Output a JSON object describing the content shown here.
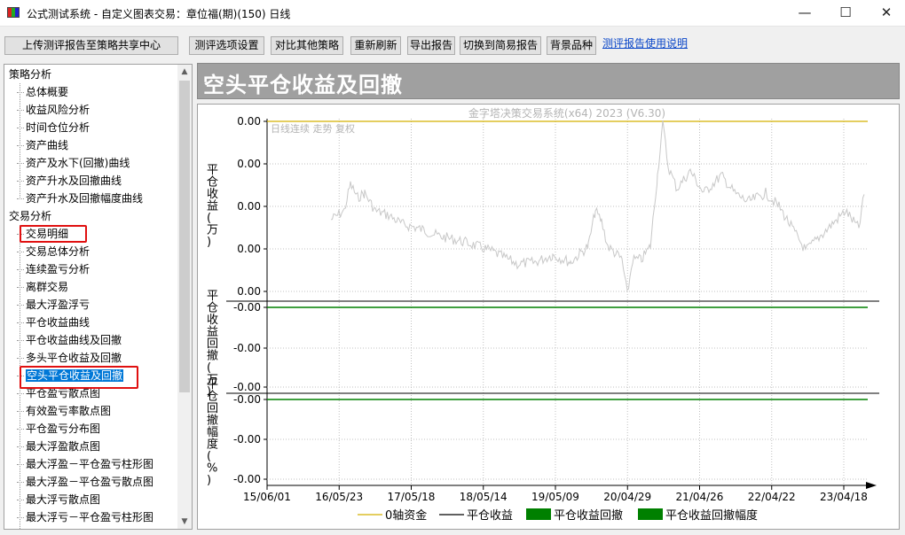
{
  "window": {
    "title": "公式测试系统 - 自定义图表交易：章位福(期)(150) 日线",
    "minimize": "—",
    "maximize": "☐",
    "close": "✕"
  },
  "toolbar": {
    "upload": "上传测评报告至策略共享中心",
    "settings": "测评选项设置",
    "compare": "对比其他策略",
    "refresh": "重新刷新",
    "export": "导出报告",
    "simple": "切换到简易报告",
    "background": "背景品种",
    "help_link": "测评报告使用说明"
  },
  "tree": {
    "groups": [
      {
        "label": "策略分析",
        "items": [
          "总体概要",
          "收益风险分析",
          "时间仓位分析",
          "资产曲线",
          "资产及水下(回撤)曲线",
          "资产升水及回撤曲线",
          "资产升水及回撤幅度曲线"
        ]
      },
      {
        "label": "交易分析",
        "items": [
          "交易明细",
          "交易总体分析",
          "连续盈亏分析",
          "离群交易",
          "最大浮盈浮亏",
          "平仓收益曲线",
          "平仓收益曲线及回撤",
          "多头平仓收益及回撤",
          "空头平仓收益及回撤",
          "平仓盈亏散点图",
          "有效盈亏率散点图",
          "平仓盈亏分布图",
          "最大浮盈散点图",
          "最大浮盈－平仓盈亏柱形图",
          "最大浮盈－平仓盈亏散点图",
          "最大浮亏散点图",
          "最大浮亏－平仓盈亏柱形图"
        ]
      }
    ],
    "selected": "空头平仓收益及回撤"
  },
  "section": {
    "title": "空头平仓收益及回撤"
  },
  "chart_data": {
    "type": "line",
    "watermark": "金字塔决策交易系统(x64) 2023 (V6.30)",
    "sub_caption": "日线连续 走势 复权",
    "panels": [
      {
        "ylabel": "平仓收益(万)",
        "ticks": [
          "0.00",
          "0.00",
          "0.00",
          "0.00",
          "0.00"
        ]
      },
      {
        "ylabel": "平仓收益回撤(万)",
        "ticks": [
          "-0.00",
          "-0.00",
          "-0.00"
        ]
      },
      {
        "ylabel": "平仓回撤幅度(%)",
        "ticks": [
          "-0.00",
          "-0.00",
          "-0.00"
        ]
      }
    ],
    "x_ticks": [
      "15/06/01",
      "16/05/23",
      "17/05/18",
      "18/05/14",
      "19/05/09",
      "20/04/29",
      "21/04/26",
      "22/04/22",
      "23/04/18"
    ],
    "legend": [
      {
        "name": "0轴资金",
        "color": "#d4b000",
        "style": "line"
      },
      {
        "name": "平仓收益",
        "color": "#000000",
        "style": "line"
      },
      {
        "name": "平仓收益回撤",
        "color": "#008000",
        "style": "box"
      },
      {
        "name": "平仓收益回撤幅度",
        "color": "#008000",
        "style": "box"
      }
    ],
    "colors": {
      "zero_line": "#d4b000",
      "background_series": "#c8c8c8",
      "drawdown": "#008000",
      "grid": "#c0c0c0"
    }
  }
}
